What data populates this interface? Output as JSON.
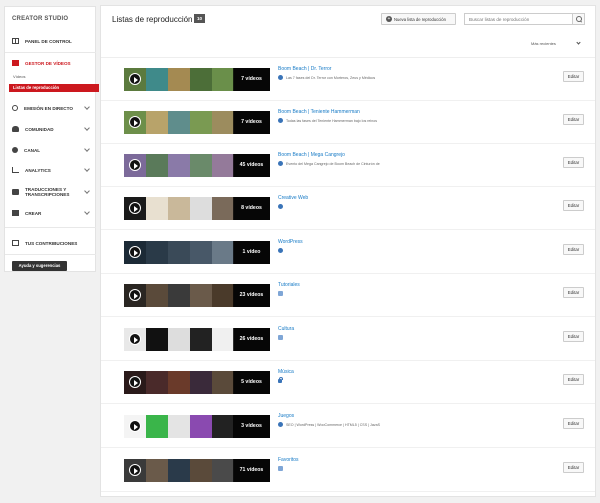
{
  "sidebar": {
    "title": "CREATOR STUDIO",
    "items": [
      {
        "label": "PANEL DE CONTROL"
      },
      {
        "label": "GESTOR DE VÍDEOS"
      },
      {
        "label": "EMISIÓN EN DIRECTO"
      },
      {
        "label": "COMUNIDAD"
      },
      {
        "label": "CANAL"
      },
      {
        "label": "ANALYTICS"
      },
      {
        "label": "TRADUCCIONES Y TRANSCRIPCIONES"
      },
      {
        "label": "CREAR"
      },
      {
        "label": "TUS CONTRIBUCIONES"
      }
    ],
    "sub_items": [
      {
        "label": "Vídeos"
      },
      {
        "label": "Listas de reproducción"
      }
    ],
    "help_button": "Ayuda y sugerencias"
  },
  "header": {
    "title": "Listas de reproducción",
    "count": "10",
    "new_button": "Nueva lista de reproducción",
    "search_placeholder": "Buscar listas de reproducción",
    "sort_label": "Más recientes"
  },
  "playlists": [
    {
      "title": "Boom Beach | Dr. Terror",
      "count": "7 vídeos",
      "visibility": "globe-icon",
      "description": "Las 7 fases del Dr. Terror con Morteros, Zeus y Médicos",
      "edit": "Editar"
    },
    {
      "title": "Boom Beach | Teniente Hammerman",
      "count": "7 vídeos",
      "visibility": "globe-icon",
      "description": "Todas las fases del Teniente Hammerman bajo los reinos",
      "edit": "Editar"
    },
    {
      "title": "Boom Beach | Mega Cangrejo",
      "count": "45 vídeos",
      "visibility": "globe-icon",
      "description": "Evento del Mega Cangrejo de Boom Beach de Cinturón de",
      "edit": "Editar"
    },
    {
      "title": "Creative Web",
      "count": "8 vídeos",
      "visibility": "globe-icon",
      "description": "",
      "edit": "Editar"
    },
    {
      "title": "WordPress",
      "count": "1 vídeo",
      "visibility": "globe-icon",
      "description": "",
      "edit": "Editar"
    },
    {
      "title": "Tutoriales",
      "count": "23 vídeos",
      "visibility": "link-icon",
      "description": "",
      "edit": "Editar"
    },
    {
      "title": "Cultura",
      "count": "26 vídeos",
      "visibility": "link-icon",
      "description": "",
      "edit": "Editar"
    },
    {
      "title": "Música",
      "count": "5 vídeos",
      "visibility": "lock-icon",
      "description": "",
      "edit": "Editar"
    },
    {
      "title": "Juegos",
      "count": "3 vídeos",
      "visibility": "globe-icon",
      "description": "SEO | WordPress | WooCommerce | HTML5 | CSS | JavaS",
      "edit": "Editar"
    },
    {
      "title": "Favoritos",
      "count": "71 vídeos",
      "visibility": "link-icon",
      "description": "",
      "edit": "Editar"
    }
  ],
  "colors": {
    "accent": "#cc181e",
    "link": "#167ac6"
  }
}
